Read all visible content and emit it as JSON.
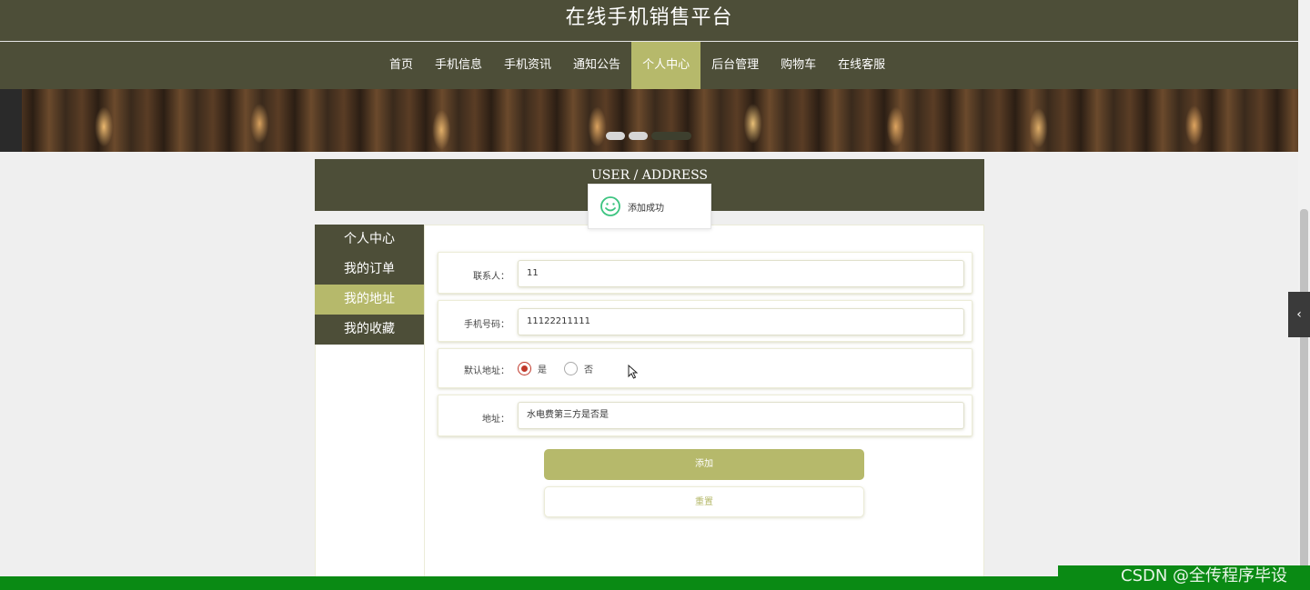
{
  "header": {
    "title": "在线手机销售平台"
  },
  "nav": {
    "items": [
      {
        "label": "首页"
      },
      {
        "label": "手机信息"
      },
      {
        "label": "手机资讯"
      },
      {
        "label": "通知公告"
      },
      {
        "label": "个人中心",
        "active": true
      },
      {
        "label": "后台管理"
      },
      {
        "label": "购物车"
      },
      {
        "label": "在线客服"
      }
    ]
  },
  "section": {
    "title": "USER / ADDRESS"
  },
  "toast": {
    "message": "添加成功"
  },
  "sidebar": {
    "items": [
      {
        "label": "个人中心"
      },
      {
        "label": "我的订单"
      },
      {
        "label": "我的地址",
        "active": true
      },
      {
        "label": "我的收藏"
      }
    ]
  },
  "form": {
    "contact": {
      "label": "联系人：",
      "value": "11"
    },
    "phone": {
      "label": "手机号码：",
      "value": "11122211111"
    },
    "default": {
      "label": "默认地址：",
      "options": [
        "是",
        "否"
      ],
      "selected": "是"
    },
    "address": {
      "label": "地址：",
      "value": "水电费第三方是否是"
    },
    "submit_label": "添加",
    "reset_label": "重置"
  },
  "watermark": "CSDN @全传程序毕设",
  "colors": {
    "primary": "#4d4e38",
    "accent": "#b6b96b",
    "radio_checked": "#c0392b",
    "success_icon": "#3cc480"
  }
}
